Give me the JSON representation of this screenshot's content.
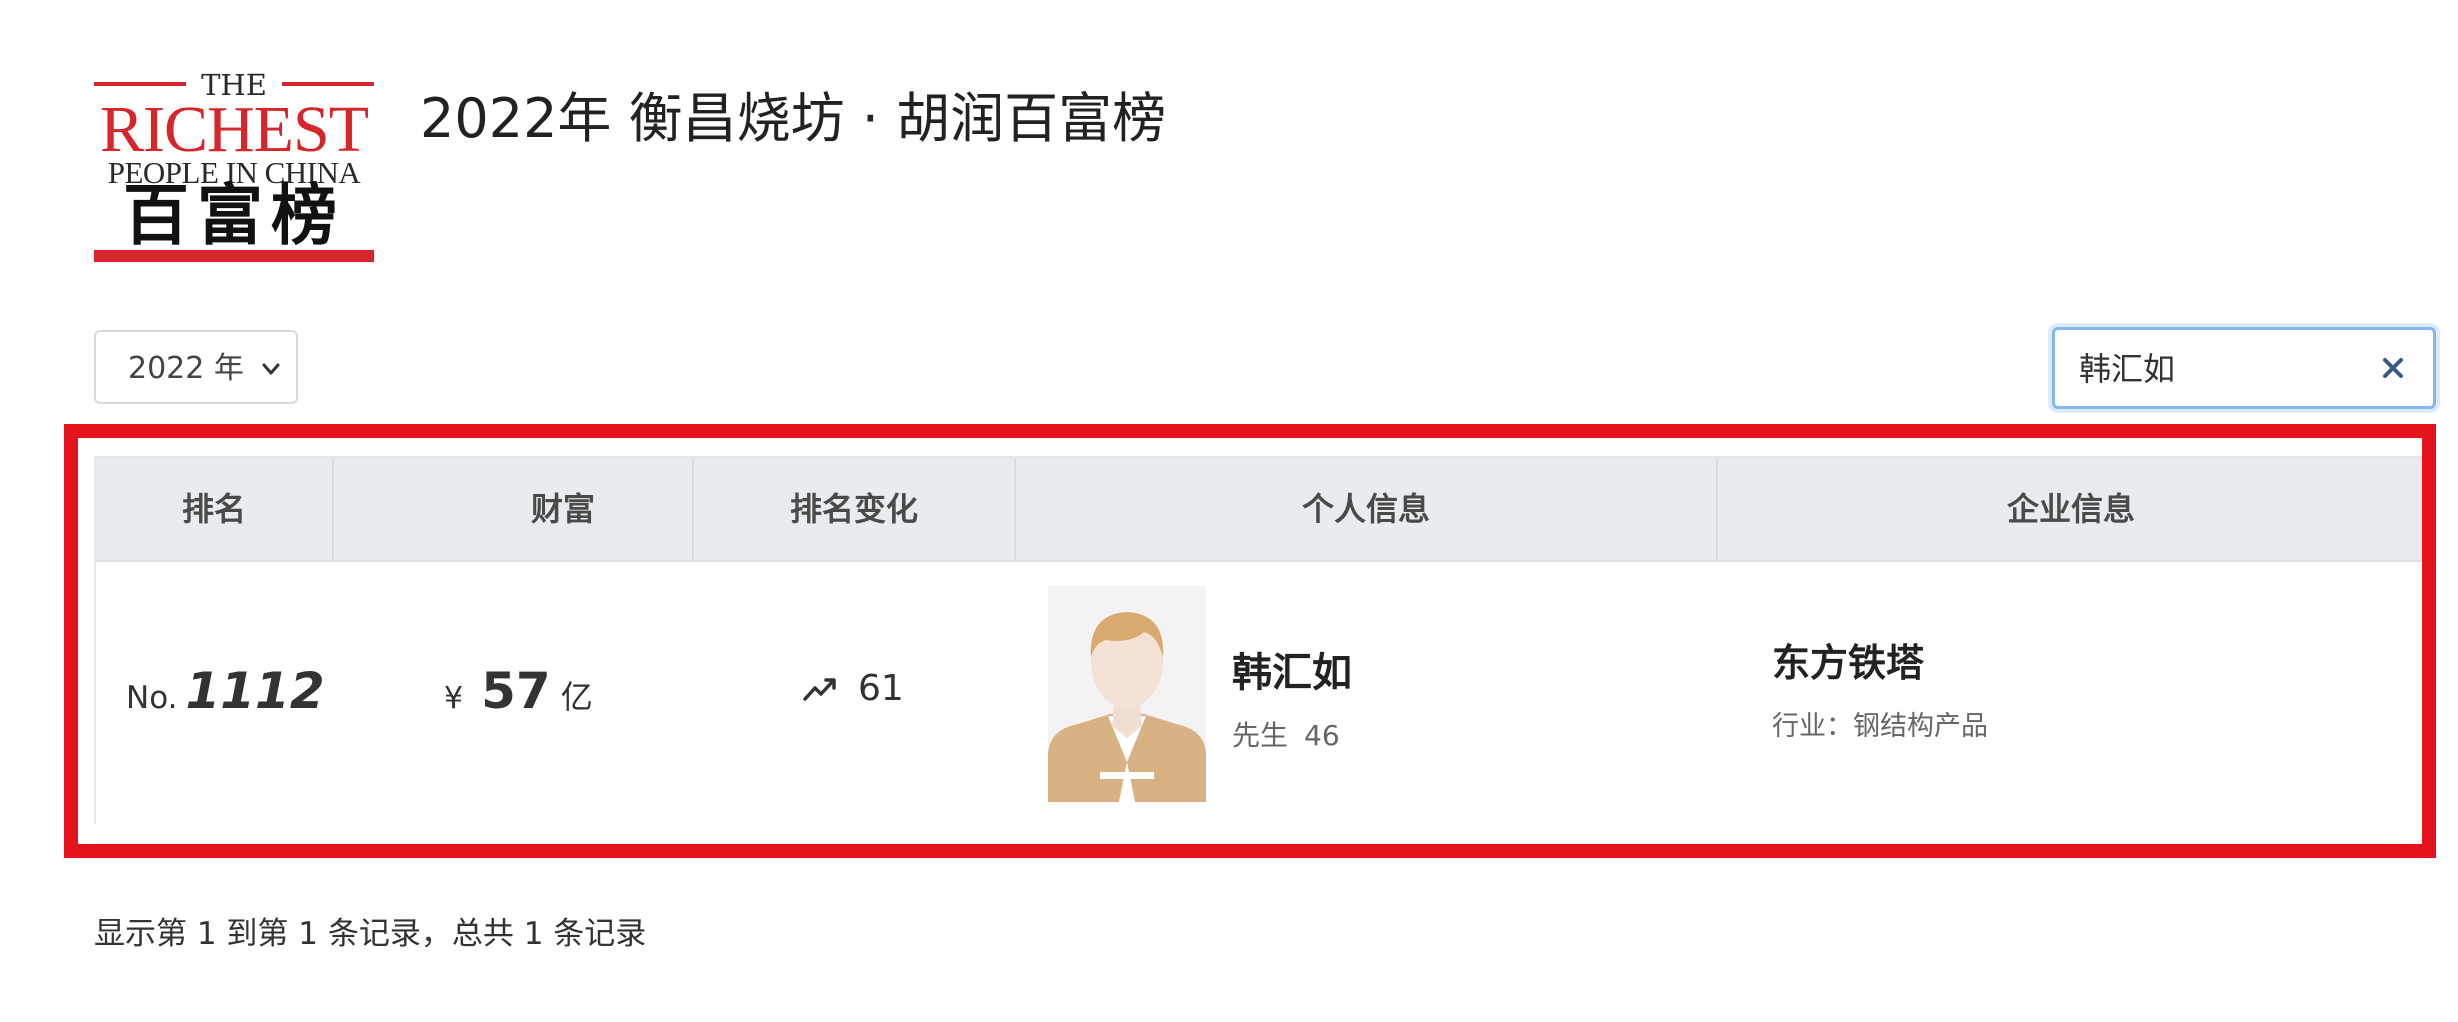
{
  "logo": {
    "the": "THE",
    "richest": "RICHEST",
    "people": "PEOPLE IN CHINA",
    "cn": "百富榜",
    "brand_color": "#d7262b"
  },
  "page_title": "2022年 衡昌烧坊 · 胡润百富榜",
  "year_select": {
    "value": "2022 年",
    "icon": "chevron-down-icon"
  },
  "search": {
    "value": "韩汇如",
    "clear_icon": "close-icon",
    "focus_color": "#82b8ee"
  },
  "highlight_color": "#e5131c",
  "table": {
    "headers": [
      "排名",
      "财富",
      "排名变化",
      "个人信息",
      "企业信息"
    ],
    "rows": [
      {
        "rank_prefix": "No.",
        "rank": "1112",
        "currency": "¥",
        "wealth": "57",
        "wealth_unit": "亿",
        "change_icon": "trend-up-icon",
        "change": "61",
        "avatar_icon": "avatar-placeholder",
        "name": "韩汇如",
        "title": "先生",
        "age": "46",
        "company": "东方铁塔",
        "industry": "行业：钢结构产品"
      }
    ]
  },
  "footer": {
    "info": "显示第 1 到第 1 条记录，总共 1 条记录"
  }
}
